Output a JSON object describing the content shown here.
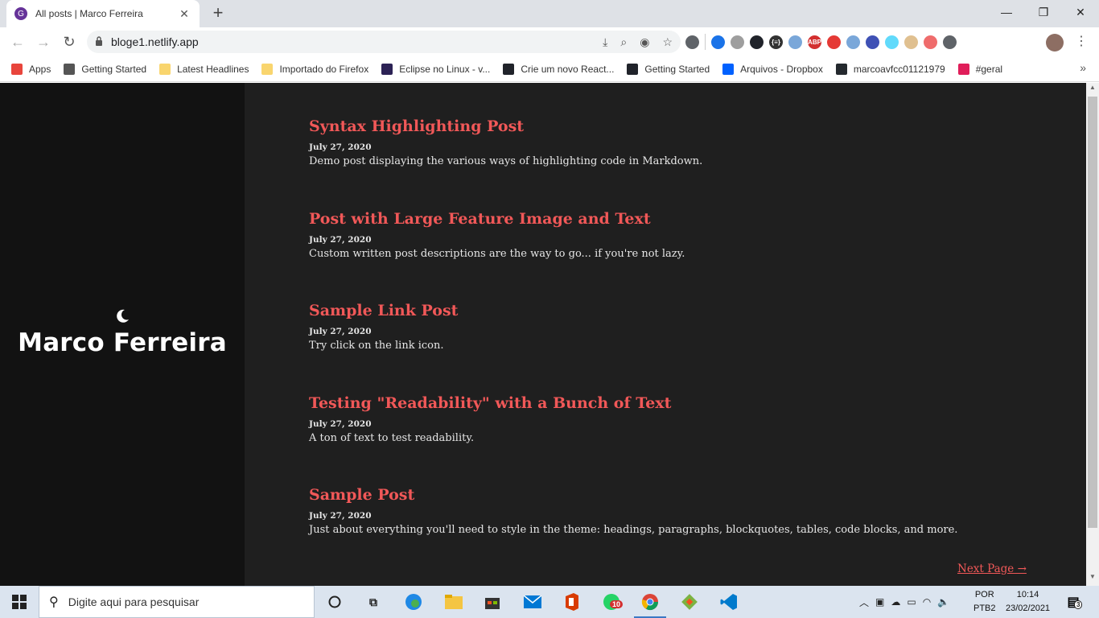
{
  "browser": {
    "tab_title": "All posts | Marco Ferreira",
    "url": "bloge1.netlify.app",
    "new_tab": "+",
    "close_tab": "✕",
    "window_minimize": "—",
    "window_maximize": "❐",
    "window_close": "✕",
    "back": "←",
    "forward": "→",
    "reload": "↻",
    "lock": "🔒",
    "menu": "⋮",
    "bookmarks_more": "»"
  },
  "bookmarks": [
    {
      "label": "Apps",
      "color": "#e8453c"
    },
    {
      "label": "Getting Started",
      "color": "#555555"
    },
    {
      "label": "Latest Headlines",
      "color": "#f9d56e"
    },
    {
      "label": "Importado do Firefox",
      "color": "#f9d56e"
    },
    {
      "label": "Eclipse no Linux - v...",
      "color": "#2c2255"
    },
    {
      "label": "Crie um novo React...",
      "color": "#20232a"
    },
    {
      "label": "Getting Started",
      "color": "#20232a"
    },
    {
      "label": "Arquivos - Dropbox",
      "color": "#0061ff"
    },
    {
      "label": "marcoavfcc01121979",
      "color": "#24292e"
    },
    {
      "label": "#geral",
      "color": "#e01e5a"
    }
  ],
  "extensions": [
    {
      "name": "settings-ext",
      "color": "#5f6368"
    },
    {
      "name": "globe-ext",
      "color": "#1a73e8"
    },
    {
      "name": "clock-ext",
      "color": "#9e9e9e"
    },
    {
      "name": "react-devtools-ext",
      "color": "#20232a"
    },
    {
      "name": "json-ext",
      "color": "#333333",
      "label": "{≡}"
    },
    {
      "name": "ext-6",
      "color": "#7aa7d9"
    },
    {
      "name": "adblock-ext",
      "color": "#d32f2f",
      "label": "ABP"
    },
    {
      "name": "youtube-ext",
      "color": "#e53935"
    },
    {
      "name": "ext-9",
      "color": "#7aa7d9"
    },
    {
      "name": "ext-10",
      "color": "#3f51b5"
    },
    {
      "name": "react-ext",
      "color": "#61dafb"
    },
    {
      "name": "ext-12",
      "color": "#e0c090"
    },
    {
      "name": "ext-13",
      "color": "#ef6c6c"
    },
    {
      "name": "puzzle-ext",
      "color": "#5f6368"
    }
  ],
  "site": {
    "title": "Marco Ferreira",
    "next_page": "Next Page →"
  },
  "posts": [
    {
      "title": "Syntax Highlighting Post",
      "date": "July 27, 2020",
      "description": "Demo post displaying the various ways of highlighting code in Markdown."
    },
    {
      "title": "Post with Large Feature Image and Text",
      "date": "July 27, 2020",
      "description": "Custom written post descriptions are the way to go... if you're not lazy."
    },
    {
      "title": "Sample Link Post",
      "date": "July 27, 2020",
      "description": "Try click on the link icon."
    },
    {
      "title": "Testing \"Readability\" with a Bunch of Text",
      "date": "July 27, 2020",
      "description": "A ton of text to test readability."
    },
    {
      "title": "Sample Post",
      "date": "July 27, 2020",
      "description": "Just about everything you'll need to style in the theme: headings, paragraphs, blockquotes, tables, code blocks, and more."
    }
  ],
  "taskbar": {
    "search_placeholder": "Digite aqui para pesquisar",
    "whatsapp_badge": "10",
    "language_top": "POR",
    "language_bottom": "PTB2",
    "time": "10:14",
    "date": "23/02/2021",
    "notifications": "3"
  },
  "colors": {
    "accent": "#f15858",
    "sidebar_bg": "#121212",
    "content_bg": "#1f1f1f"
  }
}
